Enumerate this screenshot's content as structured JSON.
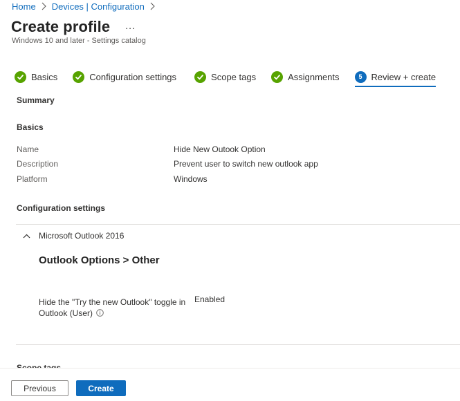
{
  "breadcrumb": {
    "items": [
      "Home",
      "Devices | Configuration"
    ]
  },
  "header": {
    "title": "Create profile",
    "more": "...",
    "subtitle": "Windows 10 and later - Settings catalog"
  },
  "wizard": {
    "steps": [
      {
        "label": "Basics",
        "state": "done"
      },
      {
        "label": "Configuration settings",
        "state": "done"
      },
      {
        "label": "Scope tags",
        "state": "done"
      },
      {
        "label": "Assignments",
        "state": "done"
      },
      {
        "label": "Review + create",
        "state": "current",
        "number": "5"
      }
    ]
  },
  "summary": {
    "heading": "Summary",
    "basics": {
      "heading": "Basics",
      "rows": [
        {
          "key": "Name",
          "value": "Hide New Outook Option"
        },
        {
          "key": "Description",
          "value": "Prevent user to switch new outlook app"
        },
        {
          "key": "Platform",
          "value": "Windows"
        }
      ]
    },
    "config": {
      "heading": "Configuration settings",
      "group": "Microsoft Outlook 2016",
      "category": "Outlook Options > Other",
      "setting_name": "Hide the \"Try the new Outlook\" toggle in Outlook (User)",
      "setting_value": "Enabled"
    },
    "scope_heading": "Scope tags"
  },
  "footer": {
    "previous": "Previous",
    "create": "Create"
  },
  "colors": {
    "accent": "#0f6cbd",
    "success": "#57a300"
  }
}
